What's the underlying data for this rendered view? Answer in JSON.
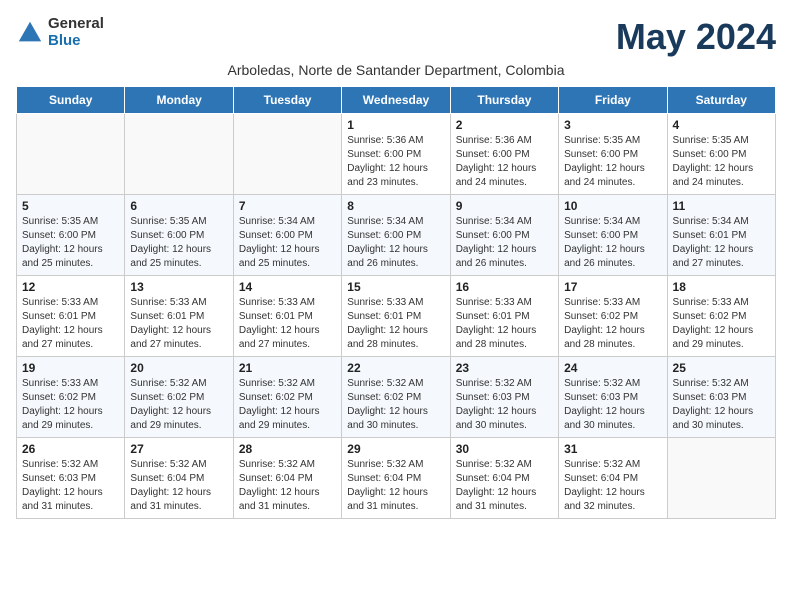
{
  "logo": {
    "general": "General",
    "blue": "Blue"
  },
  "header": {
    "month": "May 2024",
    "subtitle": "Arboledas, Norte de Santander Department, Colombia"
  },
  "weekdays": [
    "Sunday",
    "Monday",
    "Tuesday",
    "Wednesday",
    "Thursday",
    "Friday",
    "Saturday"
  ],
  "weeks": [
    [
      {
        "day": "",
        "info": ""
      },
      {
        "day": "",
        "info": ""
      },
      {
        "day": "",
        "info": ""
      },
      {
        "day": "1",
        "info": "Sunrise: 5:36 AM\nSunset: 6:00 PM\nDaylight: 12 hours\nand 23 minutes."
      },
      {
        "day": "2",
        "info": "Sunrise: 5:36 AM\nSunset: 6:00 PM\nDaylight: 12 hours\nand 24 minutes."
      },
      {
        "day": "3",
        "info": "Sunrise: 5:35 AM\nSunset: 6:00 PM\nDaylight: 12 hours\nand 24 minutes."
      },
      {
        "day": "4",
        "info": "Sunrise: 5:35 AM\nSunset: 6:00 PM\nDaylight: 12 hours\nand 24 minutes."
      }
    ],
    [
      {
        "day": "5",
        "info": "Sunrise: 5:35 AM\nSunset: 6:00 PM\nDaylight: 12 hours\nand 25 minutes."
      },
      {
        "day": "6",
        "info": "Sunrise: 5:35 AM\nSunset: 6:00 PM\nDaylight: 12 hours\nand 25 minutes."
      },
      {
        "day": "7",
        "info": "Sunrise: 5:34 AM\nSunset: 6:00 PM\nDaylight: 12 hours\nand 25 minutes."
      },
      {
        "day": "8",
        "info": "Sunrise: 5:34 AM\nSunset: 6:00 PM\nDaylight: 12 hours\nand 26 minutes."
      },
      {
        "day": "9",
        "info": "Sunrise: 5:34 AM\nSunset: 6:00 PM\nDaylight: 12 hours\nand 26 minutes."
      },
      {
        "day": "10",
        "info": "Sunrise: 5:34 AM\nSunset: 6:00 PM\nDaylight: 12 hours\nand 26 minutes."
      },
      {
        "day": "11",
        "info": "Sunrise: 5:34 AM\nSunset: 6:01 PM\nDaylight: 12 hours\nand 27 minutes."
      }
    ],
    [
      {
        "day": "12",
        "info": "Sunrise: 5:33 AM\nSunset: 6:01 PM\nDaylight: 12 hours\nand 27 minutes."
      },
      {
        "day": "13",
        "info": "Sunrise: 5:33 AM\nSunset: 6:01 PM\nDaylight: 12 hours\nand 27 minutes."
      },
      {
        "day": "14",
        "info": "Sunrise: 5:33 AM\nSunset: 6:01 PM\nDaylight: 12 hours\nand 27 minutes."
      },
      {
        "day": "15",
        "info": "Sunrise: 5:33 AM\nSunset: 6:01 PM\nDaylight: 12 hours\nand 28 minutes."
      },
      {
        "day": "16",
        "info": "Sunrise: 5:33 AM\nSunset: 6:01 PM\nDaylight: 12 hours\nand 28 minutes."
      },
      {
        "day": "17",
        "info": "Sunrise: 5:33 AM\nSunset: 6:02 PM\nDaylight: 12 hours\nand 28 minutes."
      },
      {
        "day": "18",
        "info": "Sunrise: 5:33 AM\nSunset: 6:02 PM\nDaylight: 12 hours\nand 29 minutes."
      }
    ],
    [
      {
        "day": "19",
        "info": "Sunrise: 5:33 AM\nSunset: 6:02 PM\nDaylight: 12 hours\nand 29 minutes."
      },
      {
        "day": "20",
        "info": "Sunrise: 5:32 AM\nSunset: 6:02 PM\nDaylight: 12 hours\nand 29 minutes."
      },
      {
        "day": "21",
        "info": "Sunrise: 5:32 AM\nSunset: 6:02 PM\nDaylight: 12 hours\nand 29 minutes."
      },
      {
        "day": "22",
        "info": "Sunrise: 5:32 AM\nSunset: 6:02 PM\nDaylight: 12 hours\nand 30 minutes."
      },
      {
        "day": "23",
        "info": "Sunrise: 5:32 AM\nSunset: 6:03 PM\nDaylight: 12 hours\nand 30 minutes."
      },
      {
        "day": "24",
        "info": "Sunrise: 5:32 AM\nSunset: 6:03 PM\nDaylight: 12 hours\nand 30 minutes."
      },
      {
        "day": "25",
        "info": "Sunrise: 5:32 AM\nSunset: 6:03 PM\nDaylight: 12 hours\nand 30 minutes."
      }
    ],
    [
      {
        "day": "26",
        "info": "Sunrise: 5:32 AM\nSunset: 6:03 PM\nDaylight: 12 hours\nand 31 minutes."
      },
      {
        "day": "27",
        "info": "Sunrise: 5:32 AM\nSunset: 6:04 PM\nDaylight: 12 hours\nand 31 minutes."
      },
      {
        "day": "28",
        "info": "Sunrise: 5:32 AM\nSunset: 6:04 PM\nDaylight: 12 hours\nand 31 minutes."
      },
      {
        "day": "29",
        "info": "Sunrise: 5:32 AM\nSunset: 6:04 PM\nDaylight: 12 hours\nand 31 minutes."
      },
      {
        "day": "30",
        "info": "Sunrise: 5:32 AM\nSunset: 6:04 PM\nDaylight: 12 hours\nand 31 minutes."
      },
      {
        "day": "31",
        "info": "Sunrise: 5:32 AM\nSunset: 6:04 PM\nDaylight: 12 hours\nand 32 minutes."
      },
      {
        "day": "",
        "info": ""
      }
    ]
  ]
}
